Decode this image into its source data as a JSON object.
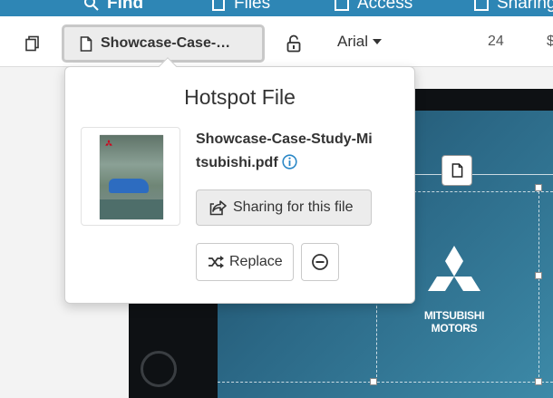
{
  "topnav": {
    "items": [
      {
        "label": "Find",
        "icon": "search-icon"
      },
      {
        "label": "Files",
        "icon": "files-icon"
      },
      {
        "label": "Access",
        "icon": "access-icon"
      },
      {
        "label": "Sharing",
        "icon": "share-icon"
      }
    ]
  },
  "toolbar": {
    "file_label": "Showcase-Case-…",
    "font_family": "Arial",
    "font_size": "24",
    "trailing_symbol": "$"
  },
  "popover": {
    "title": "Hotspot File",
    "filename_line1": "Showcase-Case-Study-Mi",
    "filename_line2": "tsubishi.pdf",
    "share_label": "Sharing for this file",
    "replace_label": "Replace"
  },
  "canvas": {
    "brand_line1": "MITSUBISHI",
    "brand_line2": "MOTORS"
  },
  "colors": {
    "nav_bg": "#2e86b5",
    "info_blue": "#2a87c6",
    "brand_red": "#d0021b"
  }
}
